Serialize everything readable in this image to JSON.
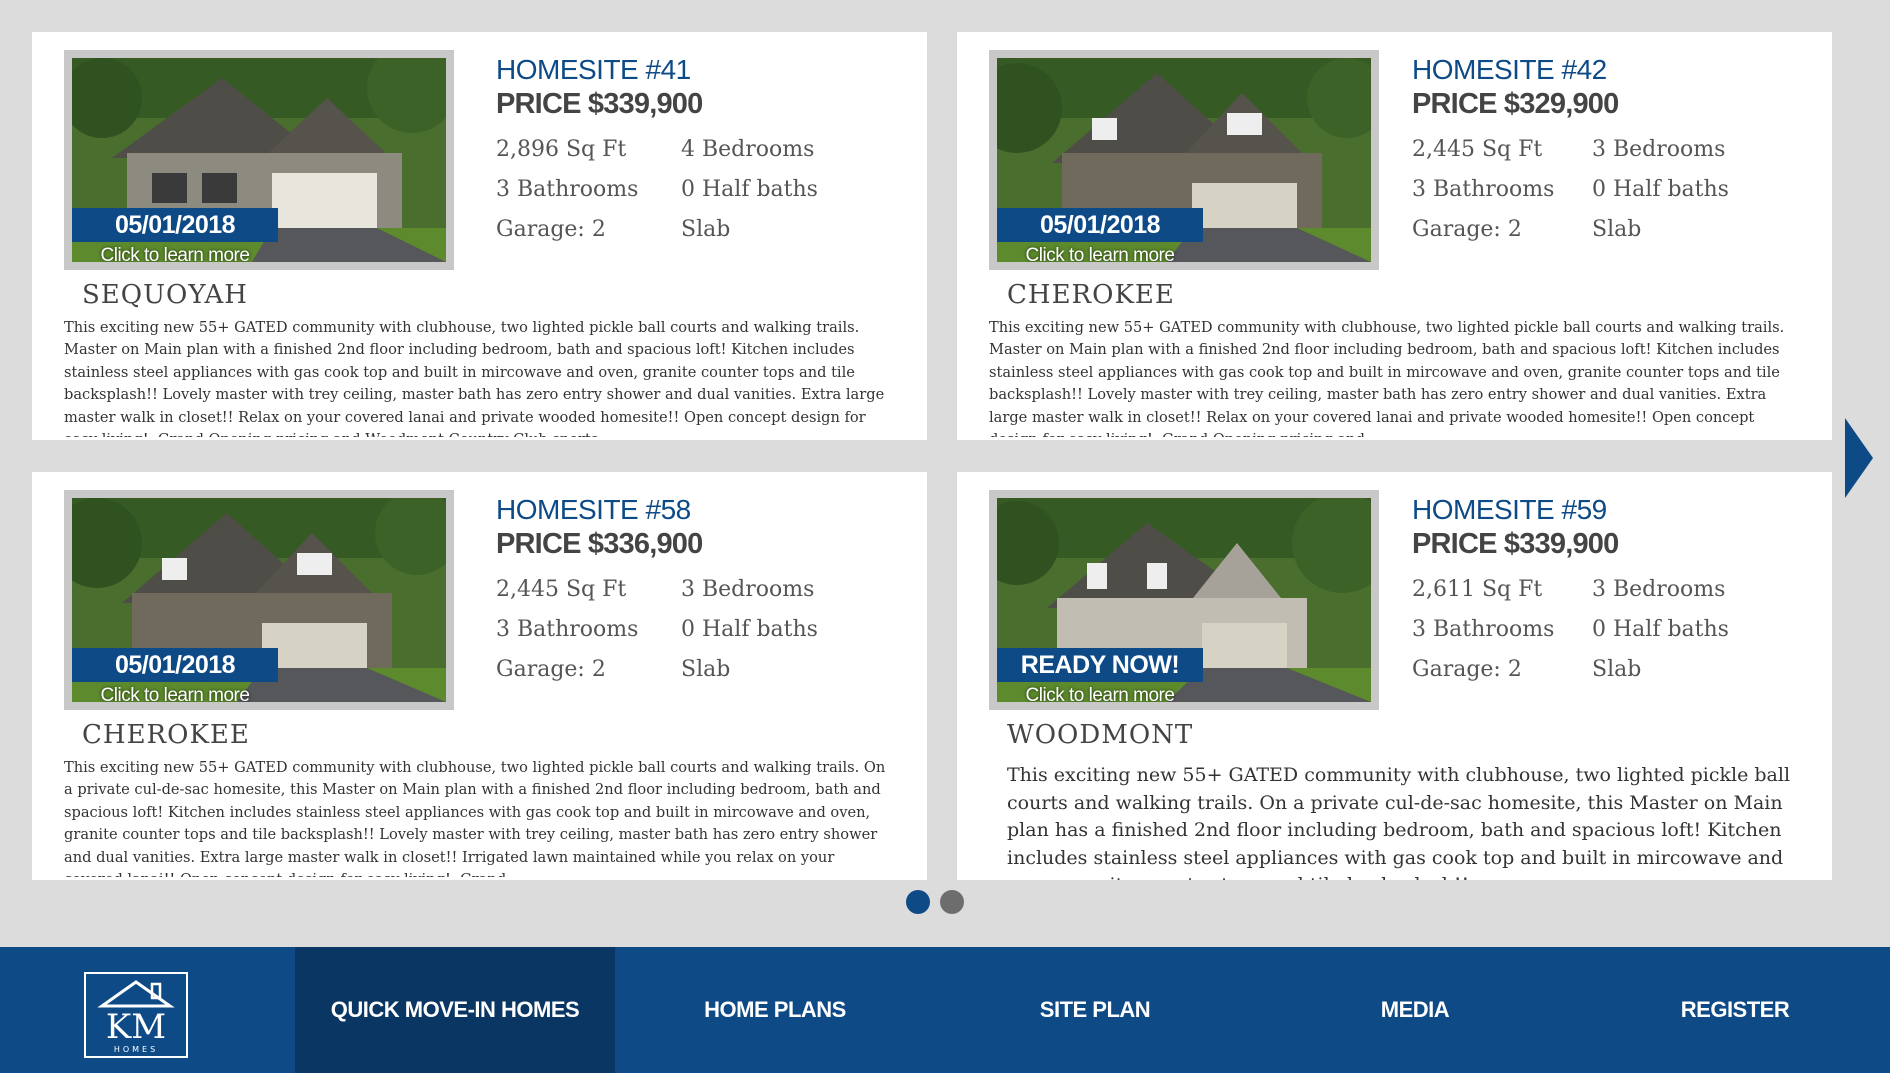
{
  "listings": [
    {
      "homesite": "HOMESITE #41",
      "price": "PRICE $339,900",
      "sqft": "2,896 Sq Ft",
      "bedrooms": "4 Bedrooms",
      "bathrooms": "3 Bathrooms",
      "half_baths": "0 Half baths",
      "garage": "Garage: 2",
      "foundation": "Slab",
      "badge": "05/01/2018",
      "learn_more": "Click to learn more",
      "plan": "SEQUOYAH",
      "description": "This exciting new 55+ GATED community with clubhouse, two lighted pickle ball courts and walking trails. Master on Main plan with a finished 2nd floor including bedroom, bath and spacious loft! Kitchen includes stainless steel appliances with gas cook top and built in mircowave and oven, granite counter tops and tile backsplash!! Lovely master with trey ceiling, master bath has zero entry shower and dual vanities. Extra large master walk in closet!! Relax on your covered lanai and private wooded homesite!! Open concept design for easy living!. Grand Opening pricing and Woodmont Country Club sports"
    },
    {
      "homesite": "HOMESITE #42",
      "price": "PRICE $329,900",
      "sqft": "2,445 Sq Ft",
      "bedrooms": "3 Bedrooms",
      "bathrooms": "3 Bathrooms",
      "half_baths": "0 Half baths",
      "garage": "Garage: 2",
      "foundation": "Slab",
      "badge": "05/01/2018",
      "learn_more": "Click to learn more",
      "plan": "CHEROKEE",
      "description": "This exciting new 55+ GATED community with clubhouse, two lighted pickle ball courts and walking trails. Master on Main plan with a finished 2nd floor including bedroom, bath and spacious loft! Kitchen includes stainless steel appliances with gas cook top and built in mircowave and oven, granite counter tops and tile backsplash!! Lovely master with trey ceiling, master bath has zero entry shower and dual vanities. Extra large master walk in closet!! Relax on your covered lanai and private wooded homesite!! Open concept design for easy living!. Grand Opening pricing and"
    },
    {
      "homesite": "HOMESITE #58",
      "price": "PRICE $336,900",
      "sqft": "2,445 Sq Ft",
      "bedrooms": "3 Bedrooms",
      "bathrooms": "3 Bathrooms",
      "half_baths": "0 Half baths",
      "garage": "Garage: 2",
      "foundation": "Slab",
      "badge": "05/01/2018",
      "learn_more": "Click to learn more",
      "plan": "CHEROKEE",
      "description": "This exciting new 55+ GATED community with clubhouse, two lighted pickle ball courts and walking trails. On a private cul-de-sac homesite, this Master on Main plan with a finished 2nd floor including bedroom, bath and spacious loft! Kitchen includes stainless steel appliances with gas cook top and built in mircowave and oven, granite counter tops and tile backsplash!! Lovely master with trey ceiling, master bath has zero entry shower and dual vanities. Extra large master walk in closet!! Irrigated lawn maintained while you relax on your covered lanai!! Open concept design for easy living!. Grand"
    },
    {
      "homesite": "HOMESITE #59",
      "price": "PRICE $339,900",
      "sqft": "2,611 Sq Ft",
      "bedrooms": "3 Bedrooms",
      "bathrooms": "3 Bathrooms",
      "half_baths": "0 Half baths",
      "garage": "Garage: 2",
      "foundation": "Slab",
      "badge": "READY NOW!",
      "learn_more": "Click to learn more",
      "plan": "WOODMONT",
      "description": "This exciting new 55+ GATED community with clubhouse, two lighted pickle ball courts and walking trails. On a private cul-de-sac homesite, this Master on Main plan has a finished 2nd floor including bedroom, bath and spacious loft! Kitchen includes stainless steel appliances with gas cook top and built in mircowave and oven, granite counter tops and tile backsplash!!"
    }
  ],
  "nav": {
    "logo_text": "KM",
    "logo_sub": "HOMES",
    "items": [
      "QUICK MOVE-IN HOMES",
      "HOME PLANS",
      "SITE PLAN",
      "MEDIA",
      "REGISTER"
    ]
  },
  "pagination": {
    "pages": 2,
    "current": 1
  },
  "colors": {
    "brand": "#0d4a86",
    "nav_active": "#093663",
    "background": "#dcdcdc"
  },
  "icons": {
    "next": "chevron-right-icon",
    "logo": "house-icon"
  }
}
